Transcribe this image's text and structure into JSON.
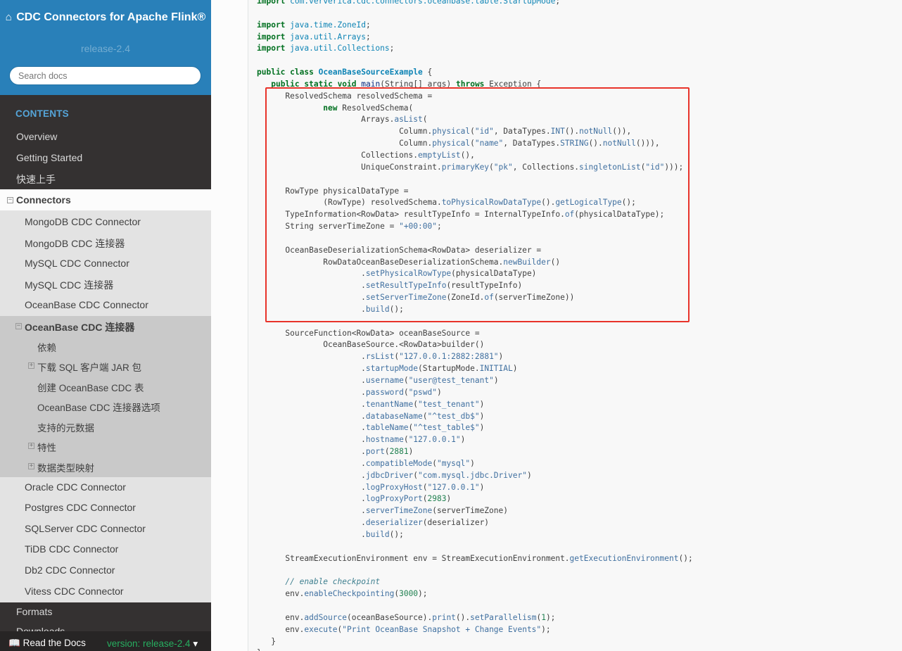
{
  "sidebar": {
    "project_title": "CDC Connectors for Apache Flink®",
    "version": "release-2.4",
    "search_placeholder": "Search docs",
    "caption": "CONTENTS",
    "top_items": [
      "Overview",
      "Getting Started",
      "快速上手"
    ],
    "connectors_label": "Connectors",
    "connector_items_before": [
      "MongoDB CDC Connector",
      "MongoDB CDC 连接器",
      "MySQL CDC Connector",
      "MySQL CDC 连接器",
      "OceanBase CDC Connector"
    ],
    "current_connector": "OceanBase CDC 连接器",
    "current_subitems": [
      "依赖",
      "下载 SQL 客户端 JAR 包",
      "创建 OceanBase CDC 表",
      "OceanBase CDC 连接器选项",
      "支持的元数据",
      "特性",
      "数据类型映射"
    ],
    "connector_items_after": [
      "Oracle CDC Connector",
      "Postgres CDC Connector",
      "SQLServer CDC Connector",
      "TiDB CDC Connector",
      "Db2 CDC Connector",
      "Vitess CDC Connector"
    ],
    "bottom_items": [
      "Formats",
      "Downloads"
    ],
    "rtd_label": "Read the Docs",
    "rtd_version": "version: release-2.4"
  },
  "code": {
    "language": "java",
    "highlight_color": "#e8332a",
    "lines": [
      "import com.ververica.cdc.connectors.oceanbase.table.StartupMode;",
      "",
      "import java.time.ZoneId;",
      "import java.util.Arrays;",
      "import java.util.Collections;",
      "",
      "public class OceanBaseSourceExample {",
      "   public static void main(String[] args) throws Exception {",
      "      ResolvedSchema resolvedSchema =",
      "              new ResolvedSchema(",
      "                      Arrays.asList(",
      "                              Column.physical(\"id\", DataTypes.INT().notNull()),",
      "                              Column.physical(\"name\", DataTypes.STRING().notNull())),",
      "                      Collections.emptyList(),",
      "                      UniqueConstraint.primaryKey(\"pk\", Collections.singletonList(\"id\")));",
      "",
      "      RowType physicalDataType =",
      "              (RowType) resolvedSchema.toPhysicalRowDataType().getLogicalType();",
      "      TypeInformation<RowData> resultTypeInfo = InternalTypeInfo.of(physicalDataType);",
      "      String serverTimeZone = \"+00:00\";",
      "",
      "      OceanBaseDeserializationSchema<RowData> deserializer =",
      "              RowDataOceanBaseDeserializationSchema.newBuilder()",
      "                      .setPhysicalRowType(physicalDataType)",
      "                      .setResultTypeInfo(resultTypeInfo)",
      "                      .setServerTimeZone(ZoneId.of(serverTimeZone))",
      "                      .build();",
      "",
      "      SourceFunction<RowData> oceanBaseSource =",
      "              OceanBaseSource.<RowData>builder()",
      "                      .rsList(\"127.0.0.1:2882:2881\")",
      "                      .startupMode(StartupMode.INITIAL)",
      "                      .username(\"user@test_tenant\")",
      "                      .password(\"pswd\")",
      "                      .tenantName(\"test_tenant\")",
      "                      .databaseName(\"^test_db$\")",
      "                      .tableName(\"^test_table$\")",
      "                      .hostname(\"127.0.0.1\")",
      "                      .port(2881)",
      "                      .compatibleMode(\"mysql\")",
      "                      .jdbcDriver(\"com.mysql.jdbc.Driver\")",
      "                      .logProxyHost(\"127.0.0.1\")",
      "                      .logProxyPort(2983)",
      "                      .serverTimeZone(serverTimeZone)",
      "                      .deserializer(deserializer)",
      "                      .build();",
      "",
      "      StreamExecutionEnvironment env = StreamExecutionEnvironment.getExecutionEnvironment();",
      "",
      "      // enable checkpoint",
      "      env.enableCheckpointing(3000);",
      "",
      "      env.addSource(oceanBaseSource).print().setParallelism(1);",
      "      env.execute(\"Print OceanBase Snapshot + Change Events\");",
      "   }",
      "}"
    ]
  }
}
